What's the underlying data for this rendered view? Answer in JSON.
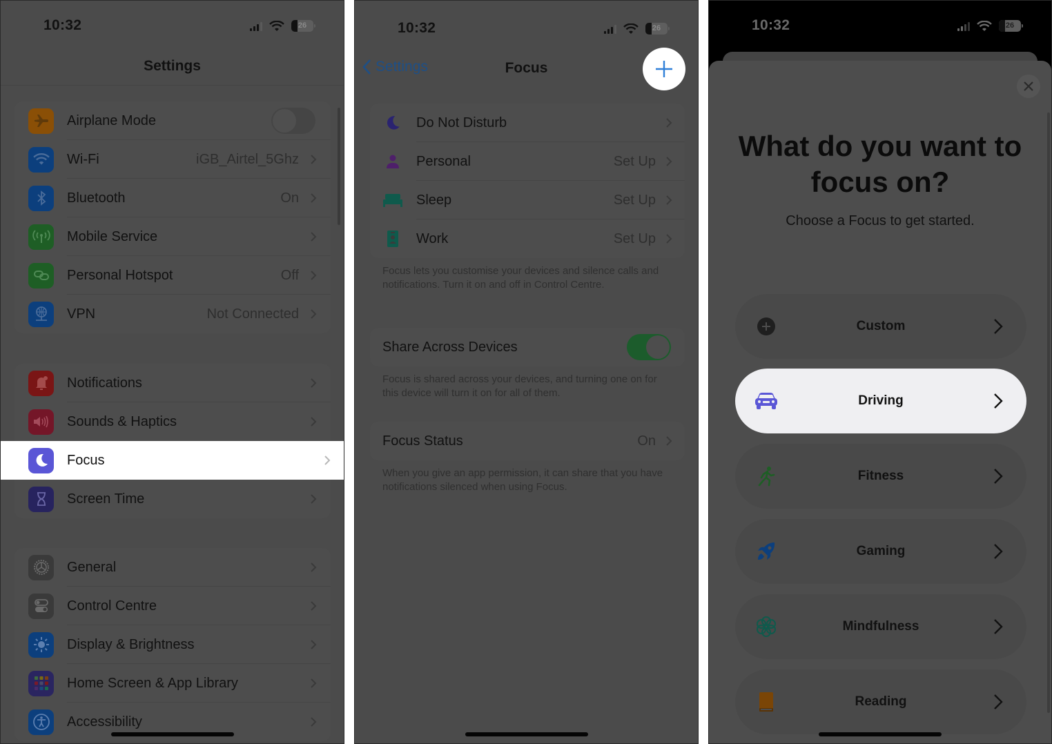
{
  "status_bar": {
    "time": "10:32",
    "battery": "26"
  },
  "settings_screen": {
    "title": "Settings",
    "groups": [
      [
        {
          "label": "Airplane Mode",
          "icon": "airplane-icon",
          "color": "#8a4f06",
          "toggle": false
        },
        {
          "label": "Wi-Fi",
          "value": "iGB_Airtel_5Ghz",
          "icon": "wifi-icon",
          "color": "#0c3f7d"
        },
        {
          "label": "Bluetooth",
          "value": "On",
          "icon": "bluetooth-icon",
          "color": "#0c3f7d"
        },
        {
          "label": "Mobile Service",
          "value": "",
          "icon": "antenna-icon",
          "color": "#1e5e25"
        },
        {
          "label": "Personal Hotspot",
          "value": "Off",
          "icon": "hotspot-link-icon",
          "color": "#1e5e25"
        },
        {
          "label": "VPN",
          "value": "Not Connected",
          "icon": "globe-icon",
          "color": "#0c3f7d"
        }
      ],
      [
        {
          "label": "Notifications",
          "icon": "bell-icon",
          "color": "#7a1515"
        },
        {
          "label": "Sounds & Haptics",
          "icon": "speaker-icon",
          "color": "#741628"
        },
        {
          "label": "Focus",
          "icon": "moon-icon",
          "color": "#5a56d6",
          "highlighted": true
        },
        {
          "label": "Screen Time",
          "icon": "hourglass-icon",
          "color": "#27235e"
        }
      ],
      [
        {
          "label": "General",
          "icon": "gear-icon",
          "color": "#3a3a3a"
        },
        {
          "label": "Control Centre",
          "icon": "switches-icon",
          "color": "#3a3a3a"
        },
        {
          "label": "Display & Brightness",
          "icon": "sun-icon",
          "color": "#0c3f7d"
        },
        {
          "label": "Home Screen & App Library",
          "icon": "app-grid-icon",
          "color": "#2a2560"
        },
        {
          "label": "Accessibility",
          "icon": "accessibility-icon",
          "color": "#0c3f7d"
        }
      ]
    ]
  },
  "focus_screen": {
    "back_label": "Settings",
    "title": "Focus",
    "add_button": "+",
    "modes": [
      {
        "label": "Do Not Disturb",
        "value": "",
        "icon": "moon-icon",
        "color": "#2a2370"
      },
      {
        "label": "Personal",
        "value": "Set Up",
        "icon": "person-icon",
        "color": "#4e1f6a"
      },
      {
        "label": "Sleep",
        "value": "Set Up",
        "icon": "bed-icon",
        "color": "#0f5a4c"
      },
      {
        "label": "Work",
        "value": "Set Up",
        "icon": "id-badge-icon",
        "color": "#0f5a4c"
      }
    ],
    "modes_note": "Focus lets you customise your devices and silence calls and notifications. Turn it on and off in Control Centre.",
    "share_label": "Share Across Devices",
    "share_on": true,
    "share_note": "Focus is shared across your devices, and turning one on for this device will turn it on for all of them.",
    "status_label": "Focus Status",
    "status_value": "On",
    "status_note": "When you give an app permission, it can share that you have notifications silenced when using Focus."
  },
  "new_focus_sheet": {
    "title": "What do you want to focus on?",
    "subtitle": "Choose a Focus to get started.",
    "options": [
      {
        "label": "Custom",
        "icon": "plus-circle-icon",
        "color": "#1f1f1f"
      },
      {
        "label": "Driving",
        "icon": "car-icon",
        "color": "#5a56d6",
        "selected": true
      },
      {
        "label": "Fitness",
        "icon": "running-icon",
        "color": "#1e5e25"
      },
      {
        "label": "Gaming",
        "icon": "rocket-icon",
        "color": "#0c3f7d"
      },
      {
        "label": "Mindfulness",
        "icon": "flower-icon",
        "color": "#0f5a4c"
      },
      {
        "label": "Reading",
        "icon": "book-icon",
        "color": "#7a4506"
      }
    ]
  }
}
